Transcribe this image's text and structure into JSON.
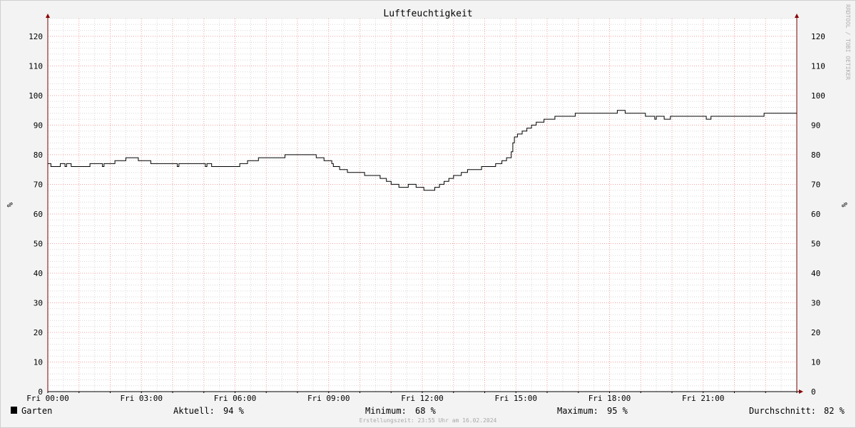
{
  "chart_data": {
    "type": "line",
    "title": "Luftfeuchtigkeit",
    "ylabel": "%",
    "ylim": [
      0,
      126
    ],
    "yticks": [
      0,
      10,
      20,
      30,
      40,
      50,
      60,
      70,
      80,
      90,
      100,
      110,
      120
    ],
    "xlabels": [
      "Fri 00:00",
      "Fri 03:00",
      "Fri 06:00",
      "Fri 09:00",
      "Fri 12:00",
      "Fri 15:00",
      "Fri 18:00",
      "Fri 21:00"
    ],
    "x_unit": "hours",
    "xlim": [
      0,
      24
    ],
    "grid": true,
    "series": [
      {
        "name": "Garten",
        "color": "#000000",
        "points": [
          [
            0.0,
            77
          ],
          [
            0.1,
            76
          ],
          [
            0.35,
            76
          ],
          [
            0.4,
            77
          ],
          [
            0.5,
            77
          ],
          [
            0.55,
            76
          ],
          [
            0.6,
            77
          ],
          [
            0.7,
            77
          ],
          [
            0.75,
            76
          ],
          [
            1.3,
            76
          ],
          [
            1.35,
            77
          ],
          [
            1.7,
            77
          ],
          [
            1.75,
            76
          ],
          [
            1.8,
            77
          ],
          [
            2.1,
            77
          ],
          [
            2.15,
            78
          ],
          [
            2.45,
            78
          ],
          [
            2.5,
            79
          ],
          [
            2.85,
            79
          ],
          [
            2.9,
            78
          ],
          [
            3.25,
            78
          ],
          [
            3.3,
            77
          ],
          [
            4.1,
            77
          ],
          [
            4.15,
            76
          ],
          [
            4.2,
            77
          ],
          [
            5.0,
            77
          ],
          [
            5.05,
            76
          ],
          [
            5.1,
            77
          ],
          [
            5.2,
            77
          ],
          [
            5.25,
            76
          ],
          [
            6.1,
            76
          ],
          [
            6.15,
            77
          ],
          [
            6.35,
            77
          ],
          [
            6.4,
            78
          ],
          [
            6.7,
            78
          ],
          [
            6.75,
            79
          ],
          [
            7.55,
            79
          ],
          [
            7.6,
            80
          ],
          [
            8.55,
            80
          ],
          [
            8.6,
            79
          ],
          [
            8.8,
            79
          ],
          [
            8.85,
            78
          ],
          [
            9.05,
            78
          ],
          [
            9.1,
            77
          ],
          [
            9.15,
            76
          ],
          [
            9.3,
            76
          ],
          [
            9.35,
            75
          ],
          [
            9.55,
            75
          ],
          [
            9.6,
            74
          ],
          [
            10.1,
            74
          ],
          [
            10.15,
            73
          ],
          [
            10.6,
            73
          ],
          [
            10.65,
            72
          ],
          [
            10.8,
            72
          ],
          [
            10.85,
            71
          ],
          [
            10.95,
            71
          ],
          [
            11.0,
            70
          ],
          [
            11.2,
            70
          ],
          [
            11.25,
            69
          ],
          [
            11.5,
            69
          ],
          [
            11.55,
            70
          ],
          [
            11.75,
            70
          ],
          [
            11.8,
            69
          ],
          [
            12.0,
            69
          ],
          [
            12.05,
            68
          ],
          [
            12.35,
            68
          ],
          [
            12.4,
            69
          ],
          [
            12.5,
            69
          ],
          [
            12.55,
            70
          ],
          [
            12.65,
            70
          ],
          [
            12.7,
            71
          ],
          [
            12.8,
            71
          ],
          [
            12.85,
            72
          ],
          [
            12.95,
            72
          ],
          [
            13.0,
            73
          ],
          [
            13.2,
            73
          ],
          [
            13.25,
            74
          ],
          [
            13.4,
            74
          ],
          [
            13.45,
            75
          ],
          [
            13.85,
            75
          ],
          [
            13.9,
            76
          ],
          [
            14.3,
            76
          ],
          [
            14.35,
            77
          ],
          [
            14.5,
            77
          ],
          [
            14.55,
            78
          ],
          [
            14.65,
            78
          ],
          [
            14.7,
            79
          ],
          [
            14.8,
            79
          ],
          [
            14.85,
            81
          ],
          [
            14.9,
            84
          ],
          [
            14.95,
            86
          ],
          [
            15.05,
            87
          ],
          [
            15.15,
            87
          ],
          [
            15.2,
            88
          ],
          [
            15.3,
            88
          ],
          [
            15.35,
            89
          ],
          [
            15.45,
            89
          ],
          [
            15.5,
            90
          ],
          [
            15.6,
            90
          ],
          [
            15.65,
            91
          ],
          [
            15.85,
            91
          ],
          [
            15.9,
            92
          ],
          [
            16.2,
            92
          ],
          [
            16.25,
            93
          ],
          [
            16.85,
            93
          ],
          [
            16.9,
            94
          ],
          [
            18.2,
            94
          ],
          [
            18.25,
            95
          ],
          [
            18.45,
            95
          ],
          [
            18.5,
            94
          ],
          [
            19.1,
            94
          ],
          [
            19.15,
            93
          ],
          [
            19.4,
            93
          ],
          [
            19.45,
            92
          ],
          [
            19.5,
            93
          ],
          [
            19.7,
            93
          ],
          [
            19.75,
            92
          ],
          [
            19.9,
            92
          ],
          [
            19.95,
            93
          ],
          [
            21.05,
            93
          ],
          [
            21.1,
            92
          ],
          [
            21.2,
            92
          ],
          [
            21.25,
            93
          ],
          [
            22.9,
            93
          ],
          [
            22.95,
            94
          ],
          [
            24.0,
            94
          ]
        ]
      }
    ]
  },
  "watermark": "RRDTOOL / TOBI OETIKER",
  "legend": {
    "series_name": "Garten",
    "aktuell_label": "Aktuell:",
    "aktuell_value": "94 %",
    "minimum_label": "Minimum:",
    "minimum_value": "68 %",
    "maximum_label": "Maximum:",
    "maximum_value": "95 %",
    "durchschnitt_label": "Durchschnitt:",
    "durchschnitt_value": "82 %"
  },
  "footer": "Erstellungszeit: 23:55 Uhr am 16.02.2024"
}
